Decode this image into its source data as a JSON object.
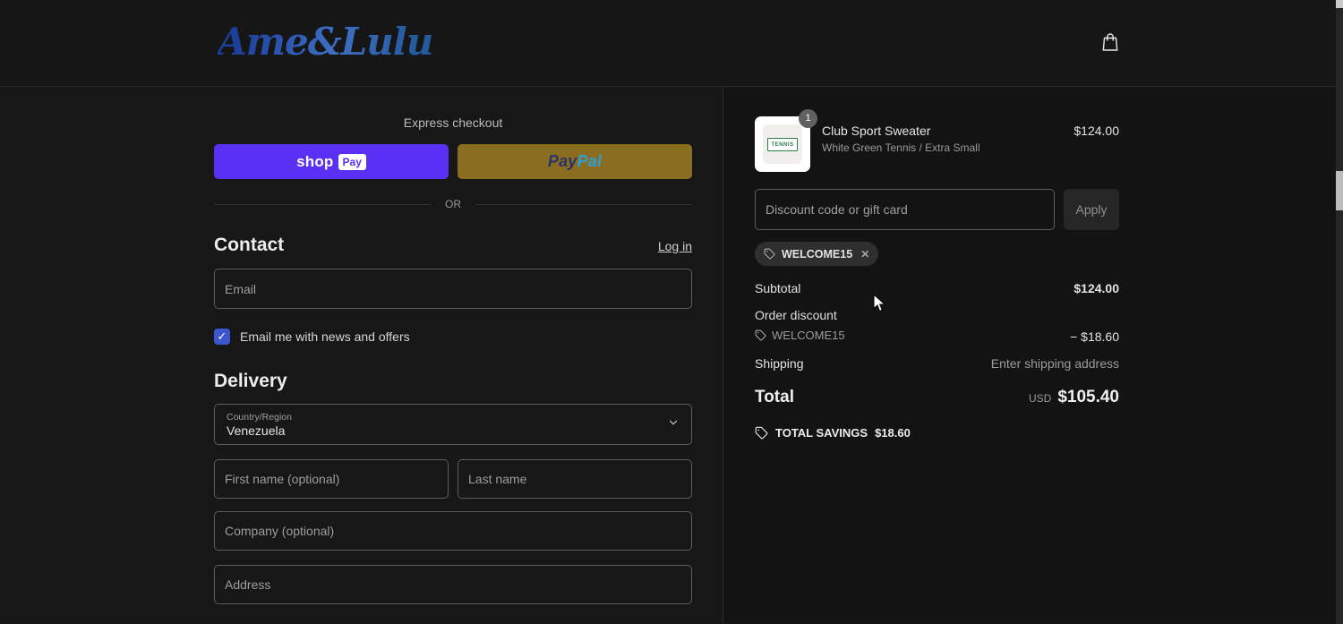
{
  "header": {
    "brand": "Ame&Lulu"
  },
  "icons": {
    "cart": "bag-icon",
    "discount": "tag-icon",
    "chevron": "chevron-down-icon",
    "close": "close-icon",
    "check": "check-icon"
  },
  "colors": {
    "shop_pay": "#5a31f4",
    "paypal_gold": "#8a6d1f",
    "checkbox_accent": "#3a57cf",
    "brand_blue": "#2f55b8",
    "page_bg": "#151515"
  },
  "express": {
    "title": "Express checkout",
    "shop_word": "shop",
    "pay_word": "Pay",
    "paypal_pay": "Pay",
    "paypal_pal": "Pal",
    "or": "OR"
  },
  "contact": {
    "title": "Contact",
    "login": "Log in",
    "email_placeholder": "Email",
    "newsletter": "Email me with news and offers",
    "check_glyph": "✓"
  },
  "delivery": {
    "title": "Delivery",
    "country_label": "Country/Region",
    "country_value": "Venezuela",
    "first_name_placeholder": "First name (optional)",
    "last_name_placeholder": "Last name",
    "company_placeholder": "Company (optional)",
    "address_placeholder": "Address"
  },
  "summary": {
    "item": {
      "qty": "1",
      "name": "Club Sport Sweater",
      "variant": "White Green Tennis / Extra Small",
      "price": "$124.00",
      "thumb_text": "TENNIS"
    },
    "discount_placeholder": "Discount code or gift card",
    "apply": "Apply",
    "chip": "WELCOME15",
    "chip_close": "✕",
    "subtotal_label": "Subtotal",
    "subtotal_value": "$124.00",
    "order_discount_label": "Order discount",
    "discount_code": "WELCOME15",
    "discount_value": "− $18.60",
    "shipping_label": "Shipping",
    "shipping_value": "Enter shipping address",
    "total_label": "Total",
    "currency": "USD",
    "total_value": "$105.40",
    "savings_label": "TOTAL SAVINGS",
    "savings_value": "$18.60"
  }
}
